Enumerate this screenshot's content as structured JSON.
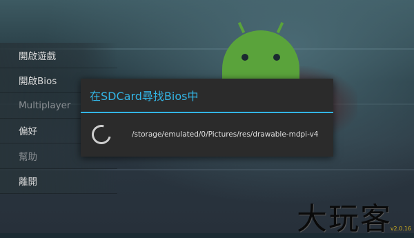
{
  "menu": {
    "items": [
      {
        "label": "開啟遊戲",
        "enabled": true
      },
      {
        "label": "開啟Bios",
        "enabled": true
      },
      {
        "label": "Multiplayer",
        "enabled": false
      },
      {
        "label": "偏好",
        "enabled": true
      },
      {
        "label": "幫助",
        "enabled": false
      },
      {
        "label": "離開",
        "enabled": true
      }
    ]
  },
  "dialog": {
    "title": "在SDCard尋找Bios中",
    "message": "/storage/emulated/0/Pictures/res/drawable-mdpi-v4",
    "accent_color": "#33b5e5",
    "icon": "loading-spinner-icon"
  },
  "brand": {
    "text": "大玩客",
    "version": "v2.0.16"
  }
}
